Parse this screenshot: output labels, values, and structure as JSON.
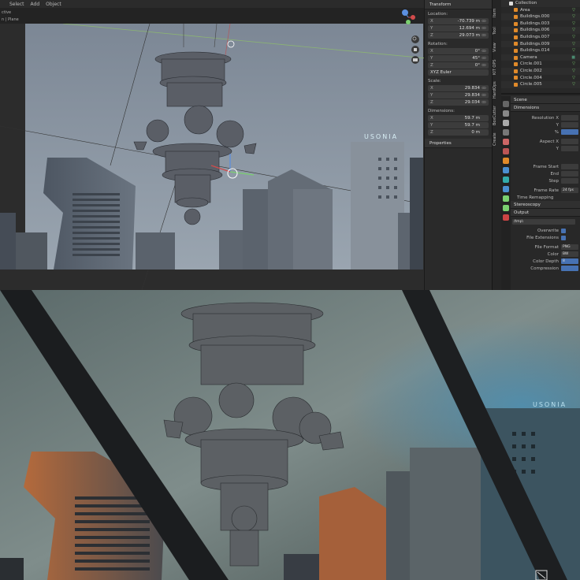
{
  "menubar": {
    "items": [
      "",
      "Select",
      "Add",
      "Object"
    ]
  },
  "side_strip": {
    "lines": [
      "ctive",
      "n | Plane"
    ]
  },
  "npanel": {
    "title": "Transform",
    "location_label": "Location:",
    "location": [
      {
        "axis": "X",
        "value": "-70.739 m"
      },
      {
        "axis": "Y",
        "value": "12.694 m"
      },
      {
        "axis": "Z",
        "value": "29.073 m"
      }
    ],
    "rotation_label": "Rotation:",
    "rotation": [
      {
        "axis": "X",
        "value": "0°"
      },
      {
        "axis": "Y",
        "value": "45°"
      },
      {
        "axis": "Z",
        "value": "0°"
      }
    ],
    "rotation_mode": "XYZ Euler",
    "scale_label": "Scale:",
    "scale": [
      {
        "axis": "X",
        "value": "29.834"
      },
      {
        "axis": "Y",
        "value": "29.834"
      },
      {
        "axis": "Z",
        "value": "29.034"
      }
    ],
    "dimensions_label": "Dimensions:",
    "dimensions": [
      {
        "axis": "X",
        "value": "59.7 m"
      },
      {
        "axis": "Y",
        "value": "59.7 m"
      },
      {
        "axis": "Z",
        "value": "0 m"
      }
    ],
    "properties_label": "Properties"
  },
  "vtabs": [
    "Item",
    "Tool",
    "View",
    "KIT OPS",
    "HardOps",
    "BoxCutter",
    "Create"
  ],
  "outliner": {
    "rows": [
      "Collection",
      "Area",
      "Buildings.000",
      "Buildings.003",
      "Buildings.006",
      "Buildings.007",
      "Buildings.009",
      "Buildings.014",
      "Camera",
      "Circle.001",
      "Circle.002",
      "Circle.004",
      "Circle.005"
    ]
  },
  "properties": {
    "scene_label": "Scene",
    "dimensions_label": "Dimensions",
    "resolution_x_label": "Resolution X",
    "y_label": "Y",
    "percent_label": "%",
    "aspect_x_label": "Aspect X",
    "aspect_y_label": "Y",
    "frame_start_label": "Frame Start",
    "end_label": "End",
    "step_label": "Step",
    "frame_rate_label": "Frame Rate",
    "frame_rate_value": "24 fps",
    "time_remapping_label": "Time Remapping",
    "stereoscopy_label": "Stereoscopy",
    "output_label": "Output",
    "output_path": "/tmp\\",
    "overwrite_label": "Overwrite",
    "file_extensions_label": "File Extensions",
    "file_format_label": "File Format",
    "file_format_value": "PNG",
    "color_label": "Color",
    "color_value": "BW",
    "color_depth_label": "Color Depth",
    "color_depth_value": "8",
    "compression_label": "Compression"
  },
  "viewport": {
    "sign_text": "USONIA"
  },
  "render": {
    "sign_text": "USONIA"
  },
  "colors": {
    "accent": "#4772b3",
    "outliner_green": "#7ad070",
    "object_orange": "#e08a2a"
  }
}
